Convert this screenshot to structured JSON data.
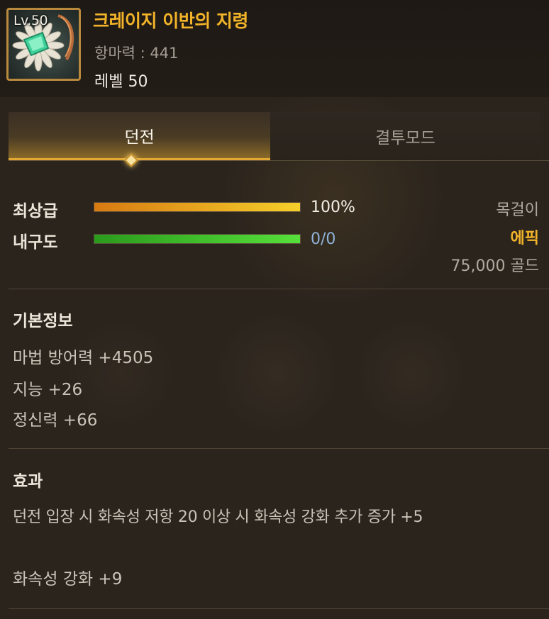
{
  "item": {
    "level_badge": "Lv.50",
    "name": "크레이지 이반의 지령",
    "power": "항마력 : 441",
    "level_text": "레벨 50"
  },
  "tabs": [
    {
      "label": "던전",
      "active": true
    },
    {
      "label": "결투모드",
      "active": false
    }
  ],
  "stats": {
    "grade": {
      "label": "최상급",
      "value": "100%",
      "fill": 1.0,
      "color": "#f0a81e"
    },
    "durability": {
      "label": "내구도",
      "value": "0/0",
      "fill": 1.0,
      "color": "#3ec42a"
    }
  },
  "info": {
    "slot": "목걸이",
    "rarity": "에픽",
    "price": "75,000 골드"
  },
  "basic": {
    "title": "기본정보",
    "lines": [
      "마법 방어력 +4505",
      "지능 +26",
      "정신력 +66"
    ]
  },
  "effect": {
    "title": "효과",
    "lines": [
      "던전 입장 시 화속성 저항 20 이상 시 화속성 강화 추가 증가 +5",
      "화속성 강화 +9"
    ]
  },
  "colors": {
    "accent": "#f3b429",
    "rarity": "#f3b429",
    "text_main": "#ece6da",
    "text_dim": "#a29c92",
    "durability_value": "#8fb3d9"
  }
}
